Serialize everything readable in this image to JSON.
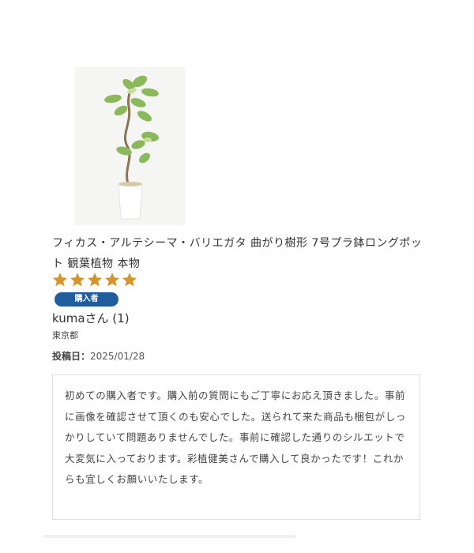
{
  "product": {
    "title": "フィカス・アルテシーマ・バリエガタ 曲がり樹形 7号プラ鉢ロングポット 観葉植物 本物",
    "image_icon": "plant-photo"
  },
  "review": {
    "rating": 5,
    "rating_max": 5,
    "star_color": "#d4962a",
    "badge_label": "購入者",
    "badge_color": "#1f5d9e",
    "reviewer": "kumaさん (1)",
    "location": "東京都",
    "posted_label": "投稿日：",
    "posted_date": "2025/01/28",
    "body": "初めての購入者です。購入前の質問にもご丁寧にお応え頂きました。事前に画像を確認させて頂くのも安心でした。送られて来た商品も梱包がしっかりしていて問題ありませんでした。事前に確認した通りのシルエットで大変気に入っております。彩植健美さんで購入して良かったです！これからも宜しくお願いいたします。"
  }
}
